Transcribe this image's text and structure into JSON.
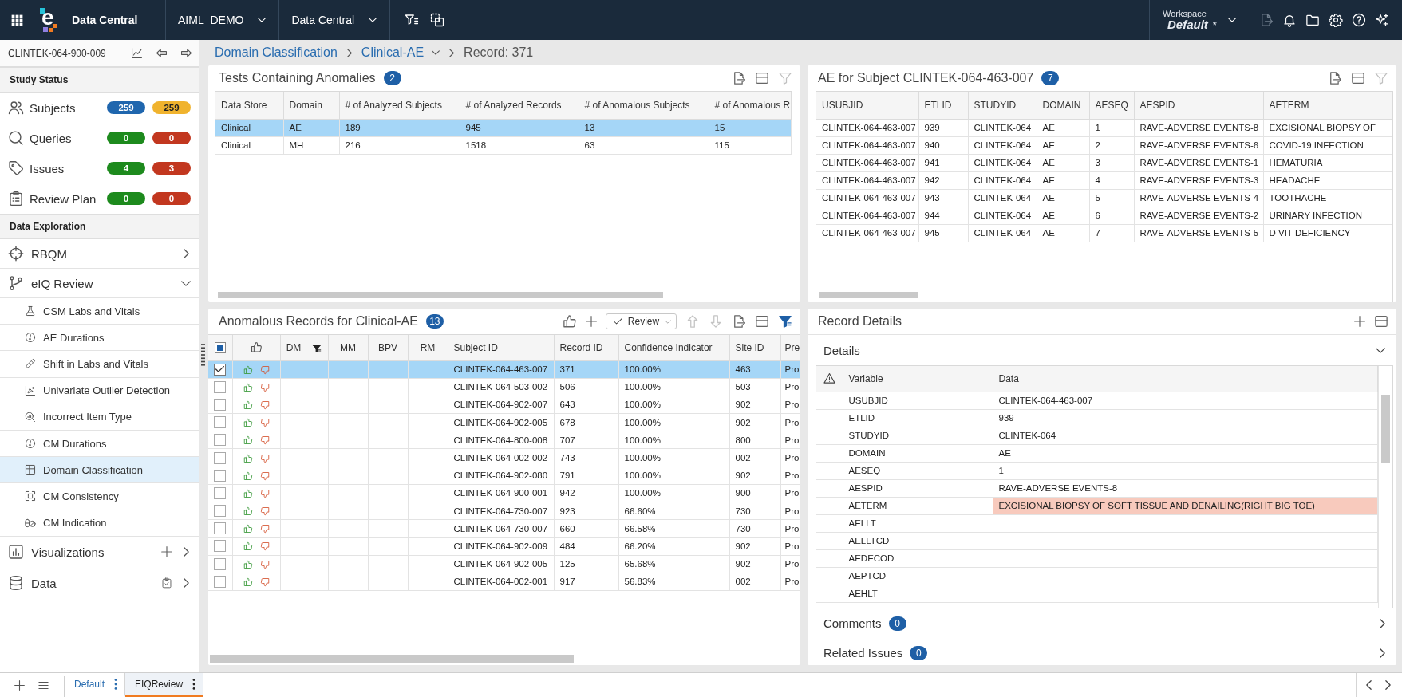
{
  "top_bar": {
    "logo_mark": "e",
    "app_name": "Data Central",
    "menus": [
      {
        "label": "AIML_DEMO"
      },
      {
        "label": "Data Central"
      }
    ],
    "workspace": {
      "caption": "Workspace",
      "value": "Default",
      "modified_mark": "*"
    },
    "actions": [
      {
        "disabled": true
      },
      {
        "disabled": false
      },
      {
        "disabled": false
      },
      {
        "disabled": false
      },
      {
        "disabled": false
      },
      {
        "disabled": false
      }
    ]
  },
  "sidebar": {
    "study_id": "CLINTEK-064-900-009",
    "study_status": {
      "title": "Study Status",
      "items": [
        {
          "label": "Subjects",
          "counts": [
            {
              "value": "259",
              "color": "#1f66ae"
            },
            {
              "value": "259",
              "color": "#f0b32e"
            }
          ]
        },
        {
          "label": "Queries",
          "counts": [
            {
              "value": "0",
              "color": "#1d8a1d"
            },
            {
              "value": "0",
              "color": "#c2371f"
            }
          ]
        },
        {
          "label": "Issues",
          "counts": [
            {
              "value": "4",
              "color": "#1d8a1d"
            },
            {
              "value": "3",
              "color": "#c2371f"
            }
          ]
        },
        {
          "label": "Review Plan",
          "counts": [
            {
              "value": "0",
              "color": "#1d8a1d"
            },
            {
              "value": "0",
              "color": "#c2371f"
            }
          ]
        }
      ]
    },
    "data_exploration": {
      "title": "Data Exploration",
      "items": [
        {
          "label": "RBQM",
          "expanded": false
        },
        {
          "label": "eIQ Review",
          "expanded": true,
          "children": [
            {
              "label": "CSM Labs and Vitals",
              "selected": false
            },
            {
              "label": "AE Durations",
              "selected": false
            },
            {
              "label": "Shift in Labs and Vitals",
              "selected": false
            },
            {
              "label": "Univariate Outlier Detection",
              "selected": false
            },
            {
              "label": "Incorrect Item Type",
              "selected": false
            },
            {
              "label": "CM Durations",
              "selected": false
            },
            {
              "label": "Domain Classification",
              "selected": true
            },
            {
              "label": "CM Consistency",
              "selected": false
            },
            {
              "label": "CM Indication",
              "selected": false
            }
          ]
        },
        {
          "label": "Visualizations",
          "expanded": false
        },
        {
          "label": "Data",
          "expanded": false
        }
      ]
    }
  },
  "breadcrumb": [
    {
      "label": "Domain Classification",
      "link": true,
      "dropdown": false
    },
    {
      "label": "Clinical-AE",
      "link": true,
      "dropdown": true
    },
    {
      "label": "Record: 371",
      "link": false,
      "dropdown": false
    }
  ],
  "tests_panel": {
    "title": "Tests Containing Anomalies",
    "count": "2",
    "filter_active": false,
    "columns": [
      "Data Store",
      "Domain",
      "# of Analyzed Subjects",
      "# of Analyzed Records",
      "# of Anomalous Subjects",
      "# of Anomalous R"
    ],
    "rows": [
      {
        "selected": true,
        "cells": [
          "Clinical",
          "AE",
          "189",
          "945",
          "13",
          "15"
        ]
      },
      {
        "selected": false,
        "cells": [
          "Clinical",
          "MH",
          "216",
          "1518",
          "63",
          "115"
        ]
      }
    ]
  },
  "ae_panel": {
    "title": "AE for Subject CLINTEK-064-463-007",
    "count": "7",
    "filter_active": false,
    "columns": [
      "USUBJID",
      "ETLID",
      "STUDYID",
      "DOMAIN",
      "AESEQ",
      "AESPID",
      "AETERM"
    ],
    "rows": [
      [
        "CLINTEK-064-463-007",
        "939",
        "CLINTEK-064",
        "AE",
        "1",
        "RAVE-ADVERSE EVENTS-8",
        "EXCISIONAL BIOPSY OF"
      ],
      [
        "CLINTEK-064-463-007",
        "940",
        "CLINTEK-064",
        "AE",
        "2",
        "RAVE-ADVERSE EVENTS-6",
        "COVID-19 INFECTION"
      ],
      [
        "CLINTEK-064-463-007",
        "941",
        "CLINTEK-064",
        "AE",
        "3",
        "RAVE-ADVERSE EVENTS-1",
        "HEMATURIA"
      ],
      [
        "CLINTEK-064-463-007",
        "942",
        "CLINTEK-064",
        "AE",
        "4",
        "RAVE-ADVERSE EVENTS-3",
        "HEADACHE"
      ],
      [
        "CLINTEK-064-463-007",
        "943",
        "CLINTEK-064",
        "AE",
        "5",
        "RAVE-ADVERSE EVENTS-4",
        "TOOTHACHE"
      ],
      [
        "CLINTEK-064-463-007",
        "944",
        "CLINTEK-064",
        "AE",
        "6",
        "RAVE-ADVERSE EVENTS-2",
        "URINARY INFECTION"
      ],
      [
        "CLINTEK-064-463-007",
        "945",
        "CLINTEK-064",
        "AE",
        "7",
        "RAVE-ADVERSE EVENTS-5",
        "D VIT DEFICIENCY"
      ]
    ]
  },
  "anomalous_panel": {
    "title": "Anomalous Records for Clinical-AE",
    "count": "13",
    "review_button": "Review",
    "move_buttons": [
      {
        "disabled": true
      },
      {
        "disabled": true
      }
    ],
    "filter_active": true,
    "select_all": {
      "checked": false,
      "indeterminate": true
    },
    "review_columns": [
      {
        "label": "DM",
        "filtered": true
      },
      {
        "label": "MM",
        "filtered": false
      },
      {
        "label": "BPV",
        "filtered": false
      },
      {
        "label": "RM",
        "filtered": false
      }
    ],
    "columns": [
      "Subject ID",
      "Record ID",
      "Confidence Indicator",
      "Site ID",
      "Pre"
    ],
    "rows": [
      {
        "checked": true,
        "selected": true,
        "cells": [
          "CLINTEK-064-463-007",
          "371",
          "100.00%",
          "463",
          "Pro"
        ]
      },
      {
        "checked": false,
        "selected": false,
        "cells": [
          "CLINTEK-064-503-002",
          "506",
          "100.00%",
          "503",
          "Pro"
        ]
      },
      {
        "checked": false,
        "selected": false,
        "cells": [
          "CLINTEK-064-902-007",
          "643",
          "100.00%",
          "902",
          "Pro"
        ]
      },
      {
        "checked": false,
        "selected": false,
        "cells": [
          "CLINTEK-064-902-005",
          "678",
          "100.00%",
          "902",
          "Pro"
        ]
      },
      {
        "checked": false,
        "selected": false,
        "cells": [
          "CLINTEK-064-800-008",
          "707",
          "100.00%",
          "800",
          "Pro"
        ]
      },
      {
        "checked": false,
        "selected": false,
        "cells": [
          "CLINTEK-064-002-002",
          "743",
          "100.00%",
          "002",
          "Pro"
        ]
      },
      {
        "checked": false,
        "selected": false,
        "cells": [
          "CLINTEK-064-902-080",
          "791",
          "100.00%",
          "902",
          "Pro"
        ]
      },
      {
        "checked": false,
        "selected": false,
        "cells": [
          "CLINTEK-064-900-001",
          "942",
          "100.00%",
          "900",
          "Pro"
        ]
      },
      {
        "checked": false,
        "selected": false,
        "cells": [
          "CLINTEK-064-730-007",
          "923",
          "66.60%",
          "730",
          "Pro"
        ]
      },
      {
        "checked": false,
        "selected": false,
        "cells": [
          "CLINTEK-064-730-007",
          "660",
          "66.58%",
          "730",
          "Pro"
        ]
      },
      {
        "checked": false,
        "selected": false,
        "cells": [
          "CLINTEK-064-902-009",
          "484",
          "66.20%",
          "902",
          "Pro"
        ]
      },
      {
        "checked": false,
        "selected": false,
        "cells": [
          "CLINTEK-064-902-005",
          "125",
          "65.68%",
          "902",
          "Pro"
        ]
      },
      {
        "checked": false,
        "selected": false,
        "cells": [
          "CLINTEK-064-002-001",
          "917",
          "56.83%",
          "002",
          "Pro"
        ]
      }
    ]
  },
  "record_panel": {
    "title": "Record Details",
    "sections": [
      {
        "title": "Details",
        "expanded": true
      },
      {
        "title": "Comments",
        "count": "0",
        "expanded": false
      },
      {
        "title": "Related Issues",
        "count": "0",
        "expanded": false
      }
    ],
    "columns": [
      "Variable",
      "Data"
    ],
    "rows": [
      {
        "variable": "USUBJID",
        "data": "CLINTEK-064-463-007",
        "flagged": false
      },
      {
        "variable": "ETLID",
        "data": "939",
        "flagged": false
      },
      {
        "variable": "STUDYID",
        "data": "CLINTEK-064",
        "flagged": false
      },
      {
        "variable": "DOMAIN",
        "data": "AE",
        "flagged": false
      },
      {
        "variable": "AESEQ",
        "data": "1",
        "flagged": false
      },
      {
        "variable": "AESPID",
        "data": "RAVE-ADVERSE EVENTS-8",
        "flagged": false
      },
      {
        "variable": "AETERM",
        "data": "EXCISIONAL BIOPSY OF SOFT TISSUE AND DENAILING(RIGHT BIG TOE)",
        "flagged": true
      },
      {
        "variable": "AELLT",
        "flagged": false
      },
      {
        "variable": "AELLTCD",
        "flagged": false
      },
      {
        "variable": "AEDECOD",
        "flagged": false
      },
      {
        "variable": "AEPTCD",
        "flagged": false
      },
      {
        "variable": "AEHLT",
        "flagged": false
      }
    ]
  },
  "bottom_bar": {
    "tabs": [
      {
        "label": "Default",
        "selected": false
      },
      {
        "label": "EIQReview",
        "selected": true
      }
    ]
  }
}
